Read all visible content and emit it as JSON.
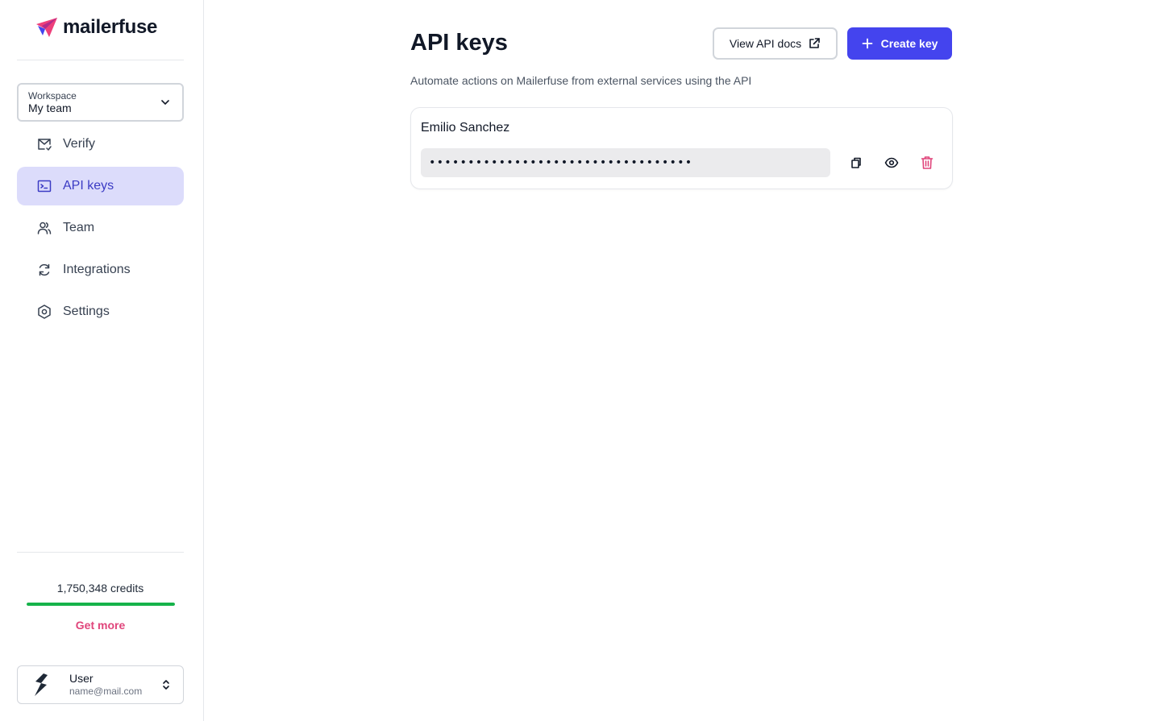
{
  "brand": {
    "name": "mailerfuse",
    "accent": "#4444ee",
    "pink": "#e0457b",
    "green": "#16b34a"
  },
  "workspace": {
    "label": "Workspace",
    "value": "My team"
  },
  "nav": [
    {
      "label": "Verify",
      "icon": "mail-check-icon",
      "active": false
    },
    {
      "label": "API keys",
      "icon": "terminal-icon",
      "active": true
    },
    {
      "label": "Team",
      "icon": "users-icon",
      "active": false
    },
    {
      "label": "Integrations",
      "icon": "refresh-icon",
      "active": false
    },
    {
      "label": "Settings",
      "icon": "gear-icon",
      "active": false
    }
  ],
  "credits": {
    "text": "1,750,348 credits",
    "progress": 1.0,
    "get_more": "Get more"
  },
  "user": {
    "name": "User",
    "email": "name@mail.com"
  },
  "page": {
    "title": "API keys",
    "subtitle": "Automate actions on Mailerfuse from external services using the API",
    "view_docs": "View API docs",
    "create_key": "Create key"
  },
  "keys": [
    {
      "name": "Emilio Sanchez",
      "masked": "••••••••••••••••••••••••••••••••••"
    }
  ]
}
